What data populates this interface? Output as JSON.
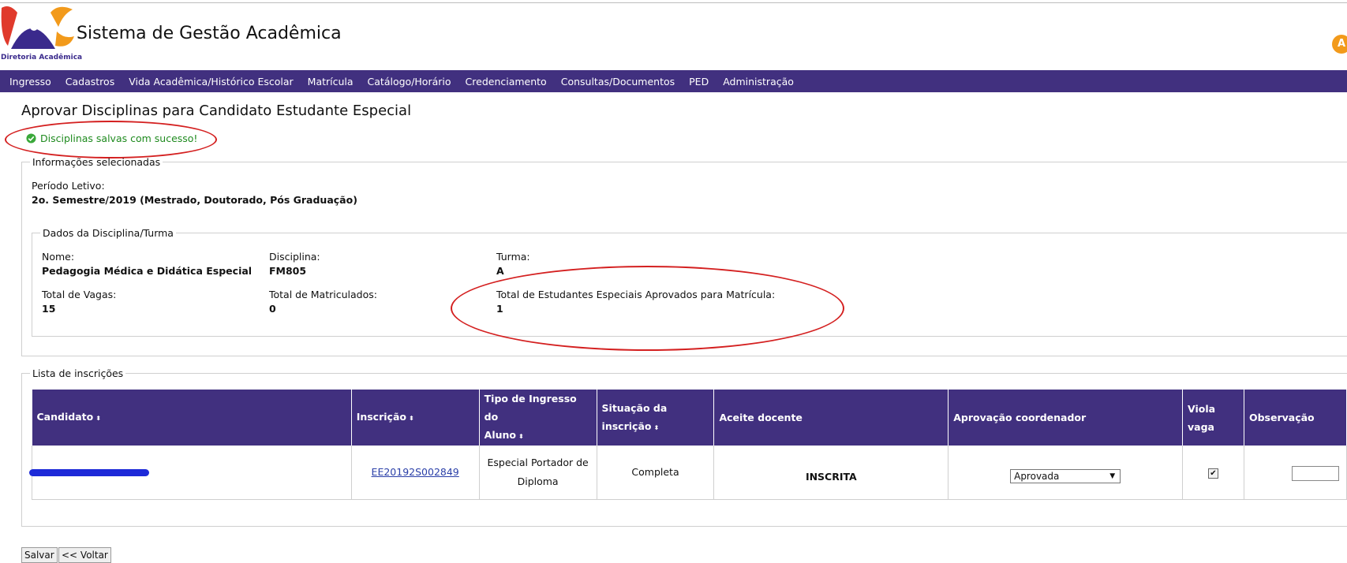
{
  "header": {
    "logo_caption": "Diretoria Acadêmica",
    "app_title": "Sistema de Gestão Acadêmica",
    "avatar_initial": "A"
  },
  "nav": {
    "items": [
      "Ingresso",
      "Cadastros",
      "Vida Acadêmica/Histórico Escolar",
      "Matrícula",
      "Catálogo/Horário",
      "Credenciamento",
      "Consultas/Documentos",
      "PED",
      "Administração"
    ]
  },
  "page": {
    "title": "Aprovar Disciplinas para Candidato Estudante Especial",
    "success_message": "Disciplinas salvas com sucesso!"
  },
  "info": {
    "legend": "Informações selecionadas",
    "periodo_label": "Período Letivo:",
    "periodo_value": "2o. Semestre/2019 (Mestrado, Doutorado, Pós Graduação)"
  },
  "turma": {
    "legend": "Dados da Disciplina/Turma",
    "nome_label": "Nome:",
    "nome_value": "Pedagogia Médica e Didática Especial",
    "disciplina_label": "Disciplina:",
    "disciplina_value": "FM805",
    "turma_label": "Turma:",
    "turma_value": "A",
    "vagas_label": "Total de Vagas:",
    "vagas_value": "15",
    "matriculados_label": "Total de Matriculados:",
    "matriculados_value": "0",
    "aprovados_label": "Total de Estudantes Especiais Aprovados para Matrícula:",
    "aprovados_value": "1"
  },
  "inscricoes": {
    "legend": "Lista de inscrições",
    "columns": {
      "candidato": "Candidato",
      "inscricao": "Inscrição",
      "tipo_l1": "Tipo de Ingresso do",
      "tipo_l2": "Aluno",
      "situacao_l1": "Situação da",
      "situacao_l2": "inscrição",
      "aceite": "Aceite docente",
      "aprovacao": "Aprovação coordenador",
      "viola_l1": "Viola",
      "viola_l2": "vaga",
      "observacao": "Observação"
    },
    "sort_icon": "⬍",
    "rows": [
      {
        "inscricao": "EE20192S002849",
        "tipo_l1": "Especial Portador de",
        "tipo_l2": "Diploma",
        "situacao": "Completa",
        "aceite": "INSCRITA",
        "aprovacao": "Aprovada",
        "viola_mark": "✔"
      }
    ]
  },
  "buttons": {
    "salvar": "Salvar",
    "voltar": "<< Voltar"
  },
  "colors": {
    "brand_purple": "#41307f",
    "success_green": "#1e8a1e",
    "annotation_red": "#d42020",
    "avatar_orange": "#f29a1b"
  }
}
